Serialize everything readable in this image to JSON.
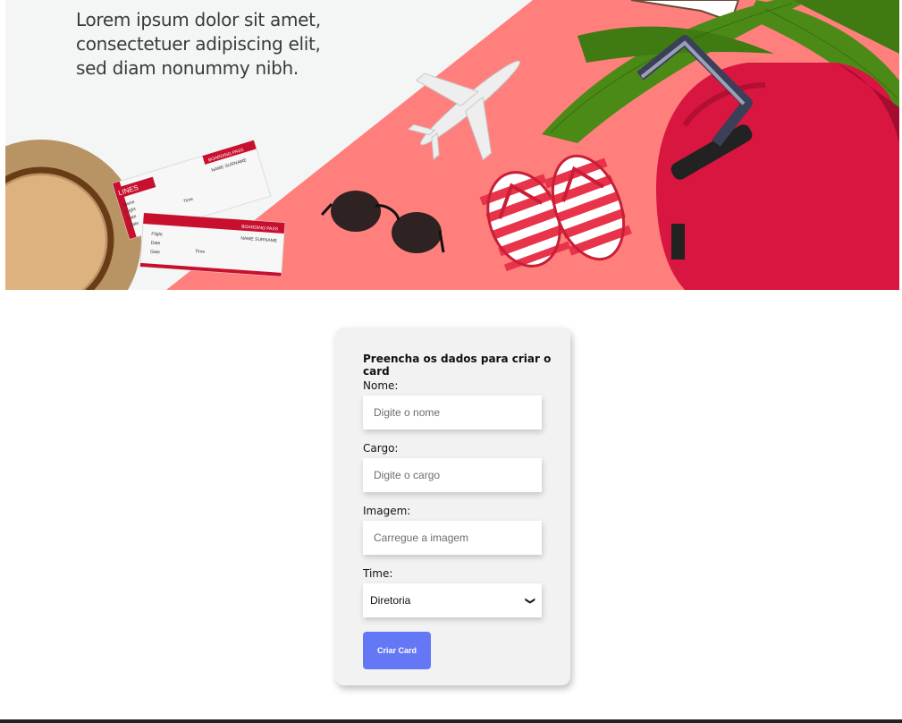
{
  "banner": {
    "tagline": [
      "Lorem ipsum dolor sit amet,",
      "consectetuer adipiscing elit,",
      "sed diam nonummy nibh."
    ],
    "ticket_top": {
      "header": "BOARDING PASS",
      "airline": "LINES",
      "name_surname": "NAME SURNAME",
      "rows": [
        "Name",
        "Flight",
        "Date",
        "Gate"
      ],
      "time": "Time"
    },
    "ticket_bottom": {
      "header": "BOARDING PASS",
      "name_surname": "NAME SURNAME",
      "rows": [
        "Flight",
        "Date",
        "Gate"
      ],
      "time": "Time"
    },
    "colors": {
      "background": "#ff7f7d",
      "paper": "#f4f6f5",
      "suitcase": "#d8163f",
      "leaves": "#3f7a12"
    }
  },
  "form": {
    "title": "Preencha os dados para criar o card",
    "nome": {
      "label": "Nome:",
      "placeholder": "Digite o nome"
    },
    "cargo": {
      "label": "Cargo:",
      "placeholder": "Digite o cargo"
    },
    "imagem": {
      "label": "Imagem:",
      "placeholder": "Carregue a imagem"
    },
    "time": {
      "label": "Time:",
      "selected": "Diretoria"
    },
    "submit_label": "Criar Card",
    "accent": "#6478f5"
  }
}
